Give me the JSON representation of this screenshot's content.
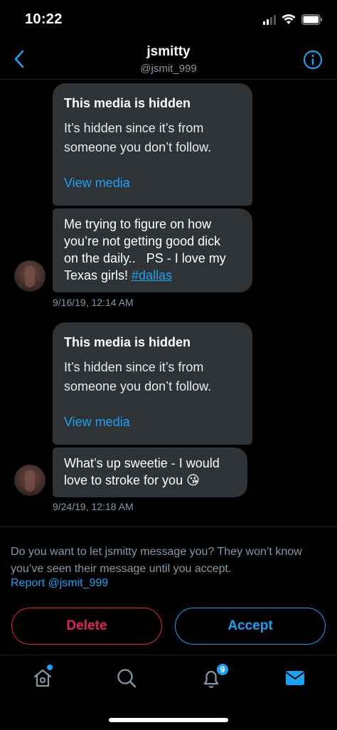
{
  "status_bar": {
    "time": "10:22"
  },
  "header": {
    "name": "jsmitty",
    "handle": "@jsmit_999"
  },
  "messages": [
    {
      "media_title": "This media is hidden",
      "media_body_line1": "It’s hidden since it’s from",
      "media_body_line2": "someone you don’t follow.",
      "media_link": "View media",
      "text_line1": "Me trying to figure on how",
      "text_line2": "you’re not getting good dick",
      "text_line3": "on the daily..   PS - I love my",
      "text_line4_prefix": "Texas girls! ",
      "hashtag": "#dallas",
      "timestamp": "9/16/19, 12:14 AM"
    },
    {
      "media_title": "This media is hidden",
      "media_body_line1": "It’s hidden since it’s from",
      "media_body_line2": "someone you don’t follow.",
      "media_link": "View media",
      "text_line1": "What’s up sweetie - I would",
      "text_line2": "love to stroke for you 😘",
      "timestamp": "9/24/19, 12:18 AM"
    }
  ],
  "request": {
    "prompt_line1": "Do you want to let jsmitty message you? They won’t know",
    "prompt_line2": "you’ve seen their message until you accept.",
    "report_label": "Report @jsmit_999",
    "delete_label": "Delete",
    "accept_label": "Accept"
  },
  "tab_bar": {
    "icons": [
      "home-icon",
      "search-icon",
      "notifications-icon",
      "messages-icon"
    ],
    "notification_count": "9"
  },
  "colors": {
    "accent": "#1da1f2",
    "danger": "#e0245e",
    "bubble": "#2f3336",
    "muted": "#8899a6"
  }
}
